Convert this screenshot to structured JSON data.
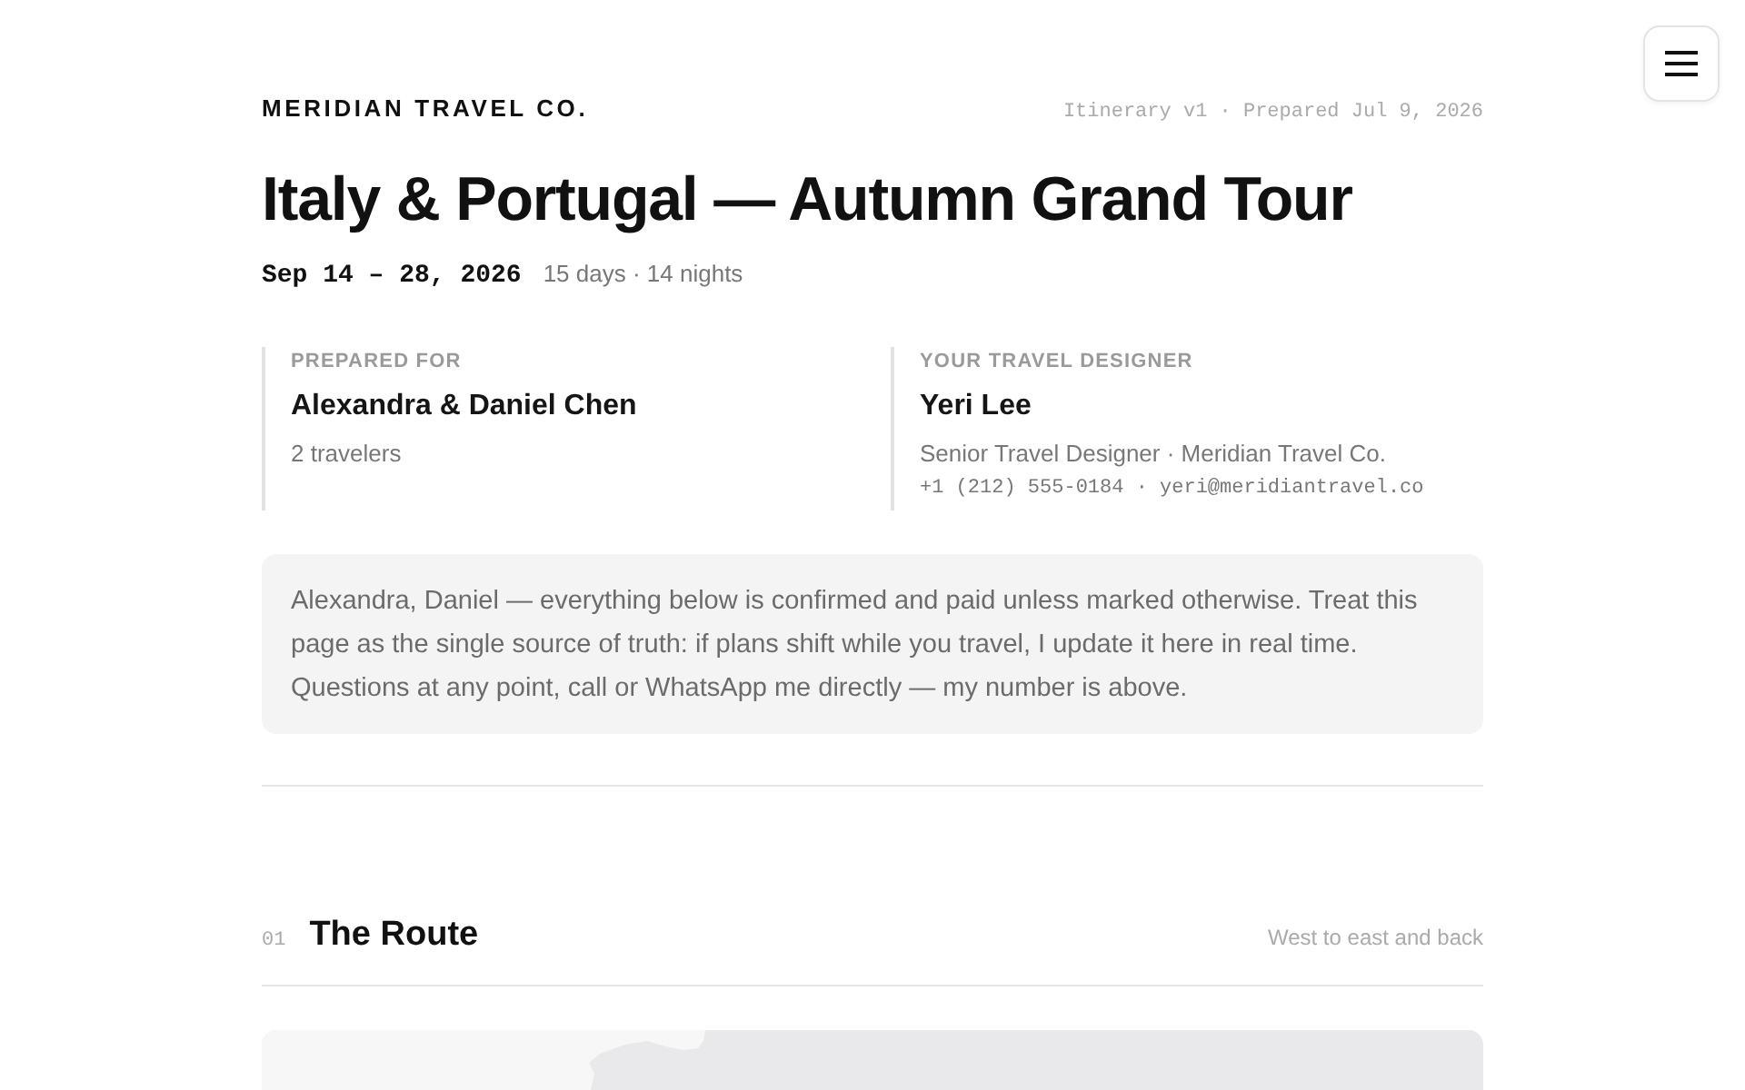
{
  "brand": "MERIDIAN TRAVEL CO.",
  "meta": "Itinerary v1 · Prepared Jul 9, 2026",
  "title": "Italy & Portugal — Autumn Grand Tour",
  "dates": "Sep 14 – 28, 2026",
  "duration": "15 days · 14 nights",
  "contacts": [
    {
      "label": "PREPARED FOR",
      "name": "Alexandra & Daniel Chen",
      "lines": [
        {
          "kind": "text",
          "text": "2 travelers"
        }
      ]
    },
    {
      "label": "YOUR TRAVEL DESIGNER",
      "name": "Yeri Lee",
      "lines": [
        {
          "kind": "text",
          "text": "Senior Travel Designer · Meridian Travel Co."
        },
        {
          "kind": "mono",
          "text": "+1 (212) 555-0184 · yeri@meridiantravel.co"
        }
      ]
    }
  ],
  "note": "Alexandra, Daniel — everything below is confirmed and paid unless marked otherwise. Treat this page as the single source of truth: if plans shift while you travel, I update it here in real time. Questions at any point, call or WhatsApp me directly — my number is above.",
  "sections": [
    {
      "number": "01",
      "title": "The Route",
      "subtitle": "West to east and back"
    }
  ]
}
